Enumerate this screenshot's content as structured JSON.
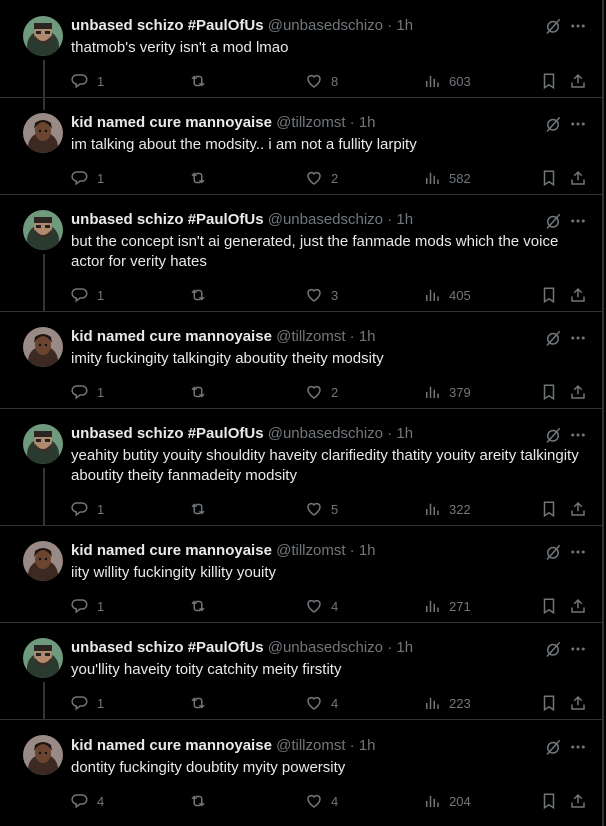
{
  "posts": [
    {
      "name": "unbased schizo #PaulOfUs",
      "handle": "@unbasedschizo",
      "dot": "·",
      "time": "1h",
      "text": "thatmob's verity isn't a mod lmao",
      "replies": "1",
      "retweets": "",
      "likes": "8",
      "views": "603",
      "avatar": "a"
    },
    {
      "name": "kid named cure mannoyaise",
      "handle": "@tillzomst",
      "dot": "·",
      "time": "1h",
      "text": "im talking about the modsity.. i am not a fullity larpity",
      "replies": "1",
      "retweets": "",
      "likes": "2",
      "views": "582",
      "avatar": "b"
    },
    {
      "name": "unbased schizo #PaulOfUs",
      "handle": "@unbasedschizo",
      "dot": "·",
      "time": "1h",
      "text": "but the concept isn't ai generated, just the fanmade mods which the voice actor for verity hates",
      "replies": "1",
      "retweets": "",
      "likes": "3",
      "views": "405",
      "avatar": "a"
    },
    {
      "name": "kid named cure mannoyaise",
      "handle": "@tillzomst",
      "dot": "·",
      "time": "1h",
      "text": "imity fuckingity talkingity aboutity theity modsity",
      "replies": "1",
      "retweets": "",
      "likes": "2",
      "views": "379",
      "avatar": "b"
    },
    {
      "name": "unbased schizo #PaulOfUs",
      "handle": "@unbasedschizo",
      "dot": "·",
      "time": "1h",
      "text": "yeahity butity youity shouldity haveity clarifiedity thatity youity areity talkingity aboutity theity fanmadeity modsity",
      "replies": "1",
      "retweets": "",
      "likes": "5",
      "views": "322",
      "avatar": "a"
    },
    {
      "name": "kid named cure mannoyaise",
      "handle": "@tillzomst",
      "dot": "·",
      "time": "1h",
      "text": "iity willity fuckingity killity youity",
      "replies": "1",
      "retweets": "",
      "likes": "4",
      "views": "271",
      "avatar": "b"
    },
    {
      "name": "unbased schizo #PaulOfUs",
      "handle": "@unbasedschizo",
      "dot": "·",
      "time": "1h",
      "text": "you'llity haveity toity catchity meity firstity",
      "replies": "1",
      "retweets": "",
      "likes": "4",
      "views": "223",
      "avatar": "a"
    },
    {
      "name": "kid named cure mannoyaise",
      "handle": "@tillzomst",
      "dot": "·",
      "time": "1h",
      "text": "dontity fuckingity doubtity myity powersity",
      "replies": "4",
      "retweets": "",
      "likes": "4",
      "views": "204",
      "avatar": "b"
    }
  ],
  "icons": {
    "reply": "reply-icon",
    "retweet": "retweet-icon",
    "like": "heart-icon",
    "views": "views-icon",
    "bookmark": "bookmark-icon",
    "share": "share-icon",
    "grok": "grok-icon",
    "more": "more-icon"
  },
  "colors": {
    "background": "#000000",
    "text": "#e7e9ea",
    "muted": "#71767b",
    "divider": "#2f3336"
  }
}
